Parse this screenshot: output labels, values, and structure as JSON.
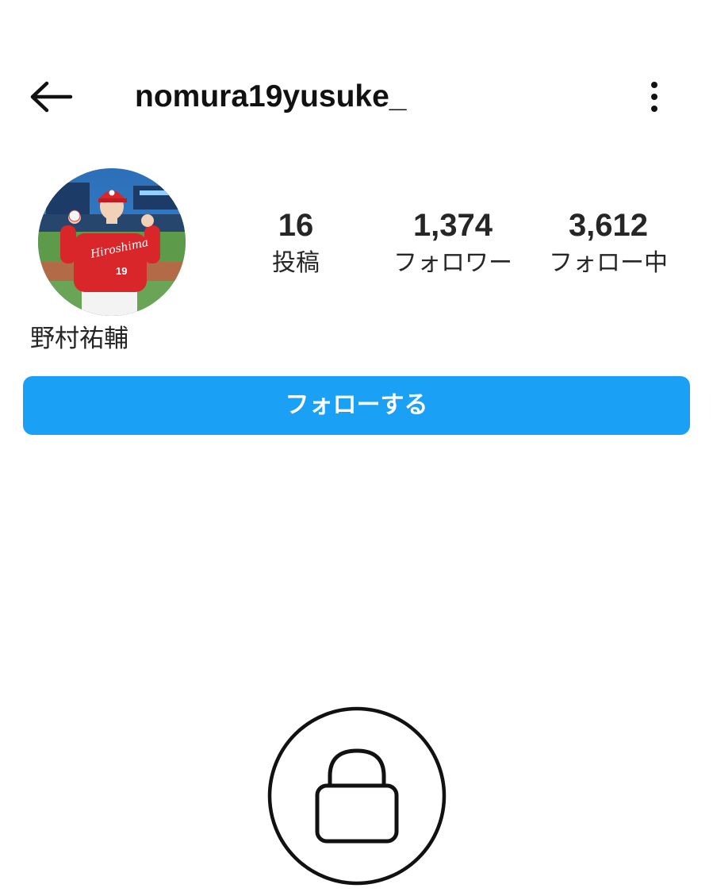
{
  "header": {
    "username": "nomura19yusuke_",
    "back_icon": "arrow-left-icon",
    "more_icon": "more-vertical-icon"
  },
  "profile": {
    "display_name": "野村祐輔",
    "avatar": {
      "jersey_text": "Hiroshima",
      "jersey_number": "19"
    },
    "stats": [
      {
        "value": "16",
        "label": "投稿"
      },
      {
        "value": "1,374",
        "label": "フォロワー"
      },
      {
        "value": "3,612",
        "label": "フォロー中"
      }
    ]
  },
  "actions": {
    "follow_label": "フォローする"
  },
  "private_notice": {
    "icon": "lock-icon"
  },
  "colors": {
    "accent": "#1aa0f5",
    "text": "#262626",
    "background": "#ffffff",
    "jersey_red": "#d9262b"
  }
}
